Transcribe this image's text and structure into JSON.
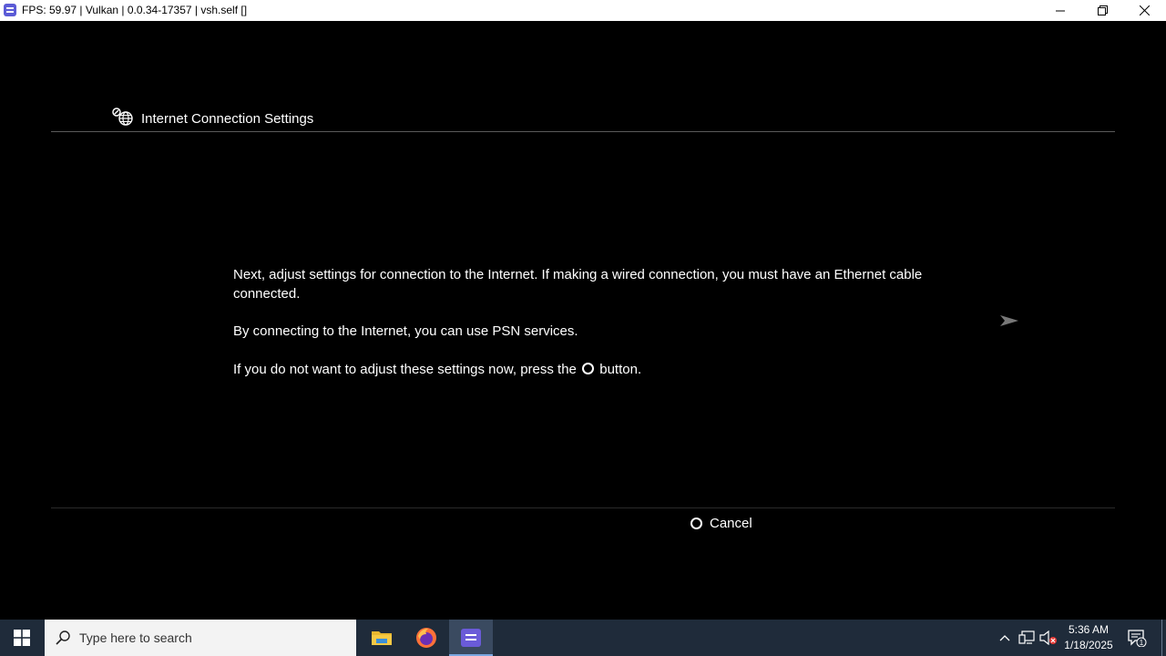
{
  "window": {
    "title": "FPS: 59.97 | Vulkan | 0.0.34-17357 | vsh.self []",
    "app_icon": "rpcs3-icon",
    "controls": [
      "minimize-icon",
      "restore-icon",
      "close-icon"
    ]
  },
  "screen": {
    "header_title": "Internet Connection Settings",
    "header_icon": "network-globe-icon",
    "paragraph1": "Next, adjust settings for connection to the Internet. If making a wired connection, you must have an Ethernet cable connected.",
    "paragraph2": "By connecting to the Internet, you can use PSN services.",
    "paragraph3_before": "If you do not want to adjust these settings now, press the",
    "paragraph3_after": "button.",
    "next_icon": "arrow-right-icon",
    "cancel_label": "Cancel",
    "cancel_icon": "circle-button-icon"
  },
  "taskbar": {
    "search_placeholder": "Type here to search",
    "apps": [
      "file-explorer-icon",
      "firefox-icon",
      "rpcs3-icon"
    ],
    "active_app": "rpcs3-icon",
    "tray_icons": [
      "chevron-up-icon",
      "network-icon",
      "volume-muted-icon"
    ],
    "time": "5:36 AM",
    "date": "1/18/2025",
    "notification_count": "1"
  },
  "colors": {
    "background": "#000000",
    "taskbar": "#1f2b3a",
    "text": "#ffffff"
  }
}
